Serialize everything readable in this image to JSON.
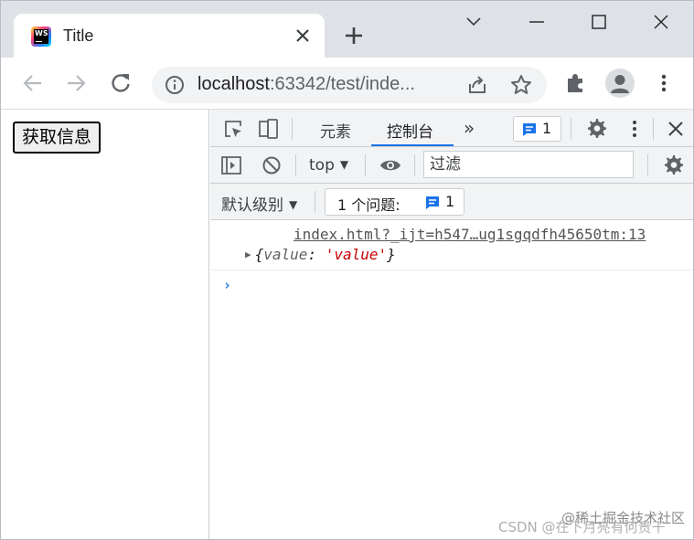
{
  "tab": {
    "title": "Title",
    "favicon_text": "WS"
  },
  "window": {
    "icons": [
      "chevron-down-icon",
      "minimize-icon",
      "maximize-icon",
      "close-icon"
    ]
  },
  "toolbar": {
    "url_host": "localhost",
    "url_rest": ":63342/test/inde...",
    "icons": [
      "back-icon",
      "forward-icon",
      "reload-icon",
      "info-icon",
      "share-icon",
      "star-icon",
      "extensions-icon",
      "profile-icon",
      "menu-icon"
    ]
  },
  "page": {
    "button_label": "获取信息"
  },
  "devtools": {
    "tabs": {
      "elements": "元素",
      "console": "控制台",
      "more": "»"
    },
    "issues_count": "1",
    "context": "top",
    "filter_placeholder": "过滤",
    "levels": "默认级别",
    "issues_chip_text": "1 个问题:",
    "issues_chip_count": "1",
    "log": {
      "source": "index.html?_ijt=h547…ug1sgqdfh45650tm:13",
      "obj_open": "{",
      "obj_key": "value",
      "obj_sep": ": ",
      "obj_value": "'value'",
      "obj_close": "}"
    },
    "prompt": "›",
    "accent_color": "#1a73e8"
  },
  "watermark": {
    "text1": "@稀土掘金技术社区",
    "text2": "CSDN @在下月亮有何贵干"
  }
}
